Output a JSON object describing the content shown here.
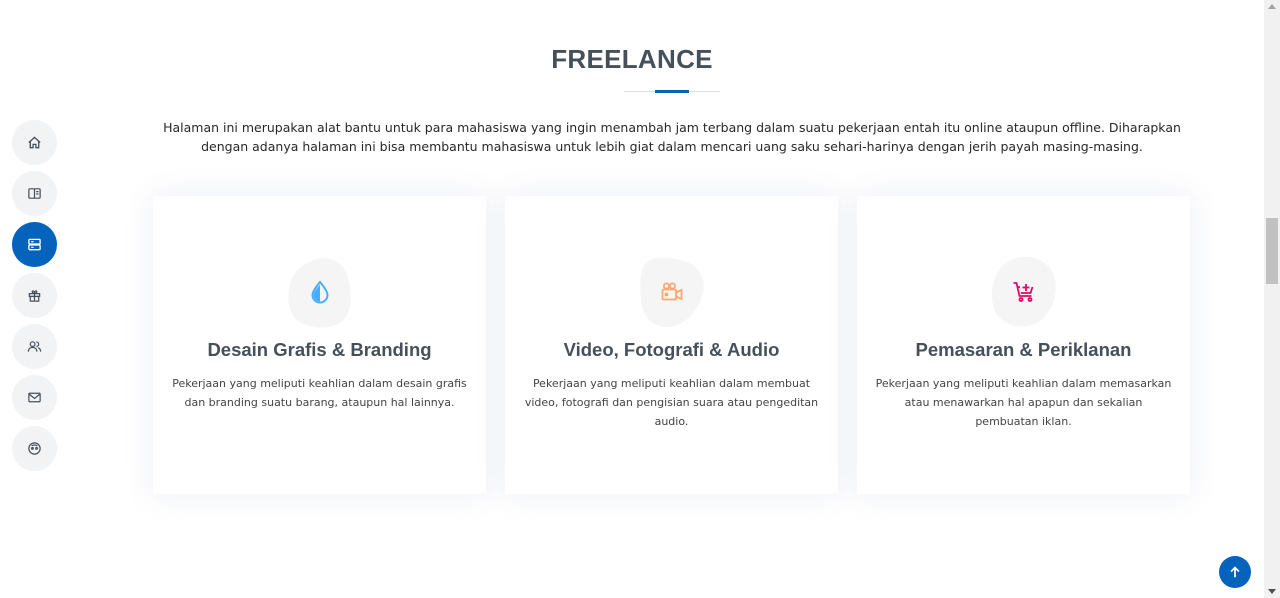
{
  "section": {
    "title": "FREELANCE",
    "intro": "Halaman ini merupakan alat bantu untuk para mahasiswa yang ingin menambah jam terbang dalam suatu pekerjaan entah itu online ataupun offline. Diharapkan dengan adanya halaman ini bisa membantu mahasiswa untuk lebih giat dalam mencari uang saku sehari-harinya dengan jerih payah masing-masing."
  },
  "nav": {
    "items": [
      {
        "icon": "home-icon",
        "active": false
      },
      {
        "icon": "book-icon",
        "active": false
      },
      {
        "icon": "server-icon",
        "active": true
      },
      {
        "icon": "gift-icon",
        "active": false
      },
      {
        "icon": "users-icon",
        "active": false
      },
      {
        "icon": "envelope-icon",
        "active": false
      },
      {
        "icon": "smiley-icon",
        "active": false
      }
    ]
  },
  "cards": [
    {
      "icon": "droplet-icon",
      "icon_color": "#47aeff",
      "title": "Desain Grafis & Branding",
      "description": "Pekerjaan yang meliputi keahlian dalam desain grafis dan branding suatu barang, ataupun hal lainnya."
    },
    {
      "icon": "video-camera-icon",
      "icon_color": "#ffa76e",
      "title": "Video, Fotografi & Audio",
      "description": "Pekerjaan yang meliputi keahlian dalam membuat video, fotografi dan pengisian suara atau pengeditan audio."
    },
    {
      "icon": "cart-plus-icon",
      "icon_color": "#e80368",
      "title": "Pemasaran & Periklanan",
      "description": "Pekerjaan yang meliputi keahlian dalam memasarkan atau menawarkan hal apapun dan sekalian pembuatan iklan."
    }
  ],
  "colors": {
    "accent": "#0563bb",
    "title": "#45505b",
    "nav_bg": "#f2f3f5",
    "blob": "#f5f5f5"
  },
  "back_to_top": {
    "icon": "arrow-up-icon"
  }
}
